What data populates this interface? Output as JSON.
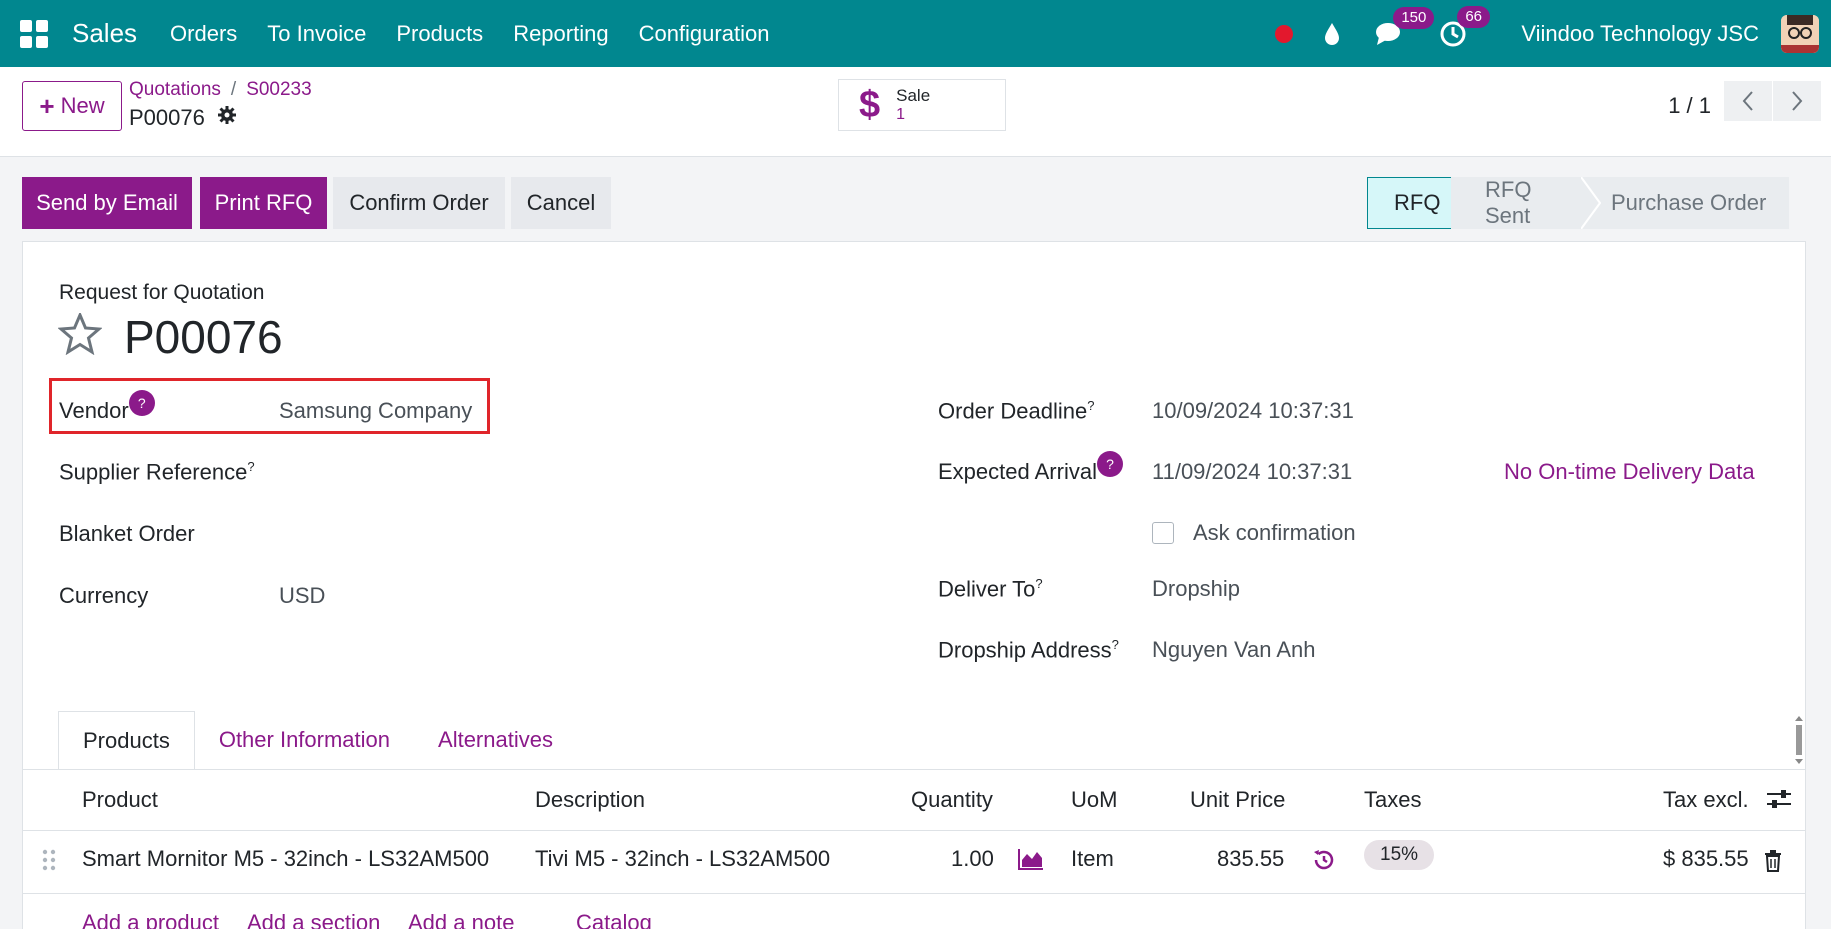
{
  "nav": {
    "brand": "Sales",
    "items": [
      "Orders",
      "To Invoice",
      "Products",
      "Reporting",
      "Configuration"
    ],
    "messages_count": "150",
    "activities_count": "66",
    "company": "Viindoo Technology JSC"
  },
  "control": {
    "new_label": "New",
    "breadcrumb": [
      "Quotations",
      "S00233"
    ],
    "record": "P00076",
    "smart_button": {
      "label": "Sale",
      "count": "1"
    },
    "pager": "1 / 1"
  },
  "actions": {
    "send_email": "Send by Email",
    "print_rfq": "Print RFQ",
    "confirm": "Confirm Order",
    "cancel": "Cancel"
  },
  "statusbar": [
    "RFQ",
    "RFQ Sent",
    "Purchase Order"
  ],
  "form": {
    "title_small": "Request for Quotation",
    "title": "P00076",
    "vendor_label": "Vendor",
    "vendor_value": "Samsung Company",
    "supplier_ref_label": "Supplier Reference",
    "blanket_label": "Blanket Order",
    "currency_label": "Currency",
    "currency_value": "USD",
    "deadline_label": "Order Deadline",
    "deadline_value": "10/09/2024 10:37:31",
    "arrival_label": "Expected Arrival",
    "arrival_value": "11/09/2024 10:37:31",
    "ontime_label": "No On-time Delivery Data",
    "ask_confirm_label": "Ask confirmation",
    "deliver_label": "Deliver To",
    "deliver_value": "Dropship",
    "dropship_label": "Dropship Address",
    "dropship_value": "Nguyen Van Anh",
    "help": "?",
    "sup": "?"
  },
  "tabs": [
    "Products",
    "Other Information",
    "Alternatives"
  ],
  "table": {
    "headers": [
      "Product",
      "Description",
      "Quantity",
      "UoM",
      "Unit Price",
      "Taxes",
      "Tax excl."
    ],
    "row": {
      "product": "Smart Mornitor M5 - 32inch - LS32AM500",
      "description": "Tivi M5 - 32inch - LS32AM500",
      "quantity": "1.00",
      "uom": "Item",
      "unit_price": "835.55",
      "taxes": "15%",
      "subtotal": "$ 835.55"
    },
    "links": [
      "Add a product",
      "Add a section",
      "Add a note",
      "Catalog"
    ]
  }
}
